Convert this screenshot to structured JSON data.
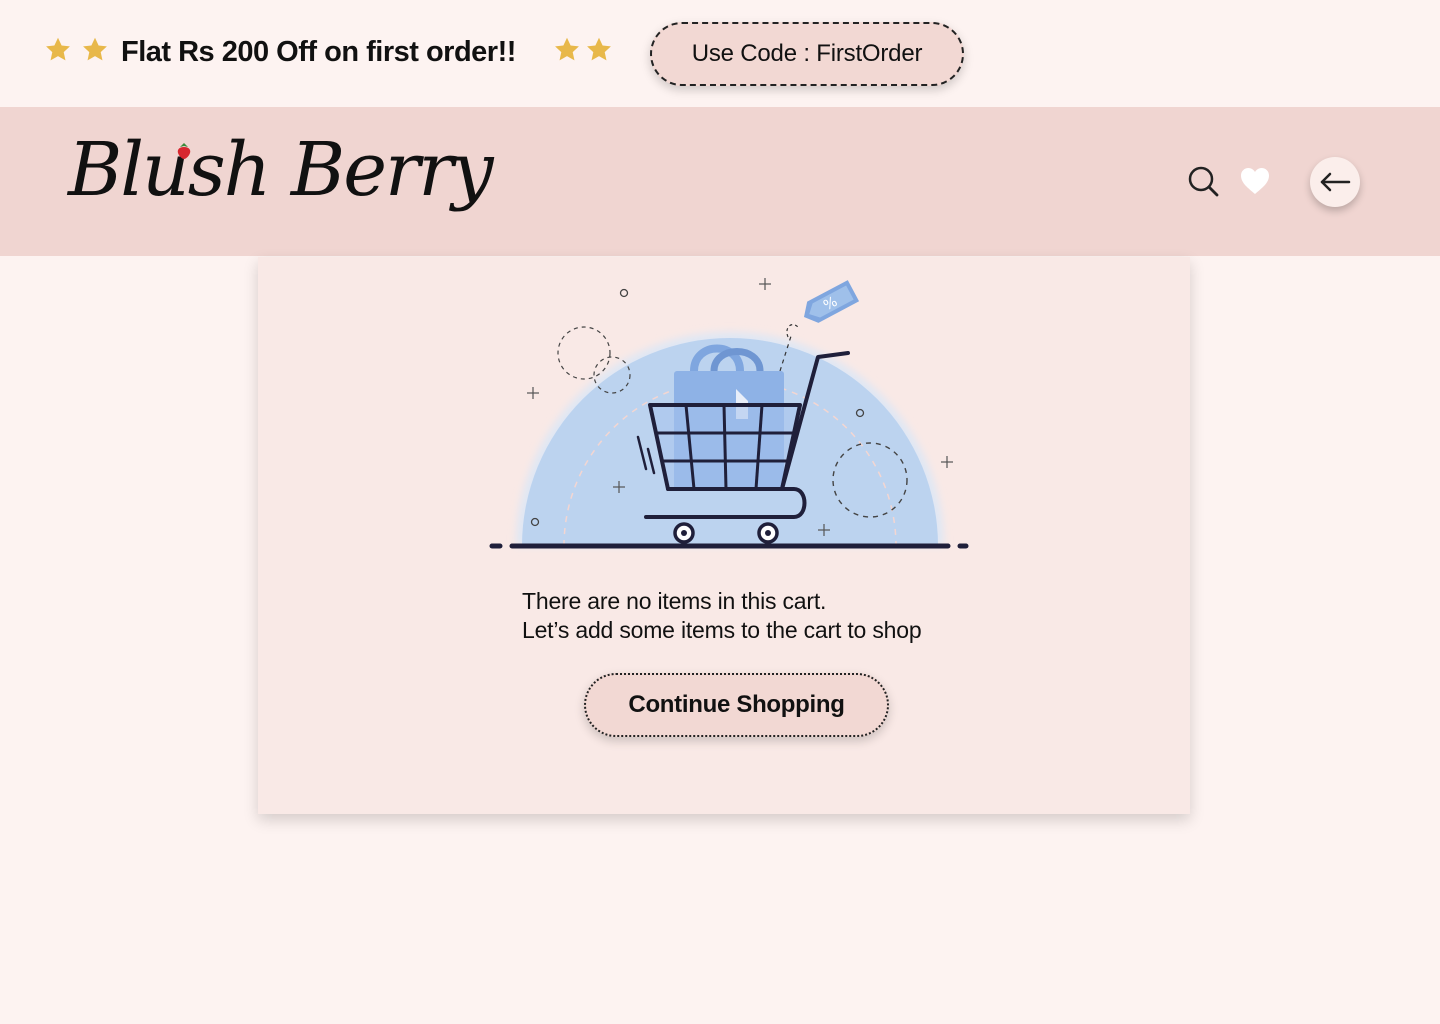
{
  "promo": {
    "text": "Flat Rs 200 Off on first order!!",
    "code_label": "Use Code : FirstOrder",
    "star_color": "#e8b84a"
  },
  "header": {
    "logo": "Blush Berry",
    "icons": [
      "search-icon",
      "heart-icon",
      "arrow-left-icon"
    ]
  },
  "cart": {
    "empty_line1": "There are no items in this cart.",
    "empty_line2": "Let’s add some items to the cart to shop",
    "continue_label": "Continue Shopping"
  },
  "colors": {
    "background": "#fdf3f1",
    "header_bg": "#f0d5d1",
    "card_bg": "#f9e9e6",
    "pill_bg": "#f2d8d3",
    "accent_blue": "#bcd3ef"
  }
}
